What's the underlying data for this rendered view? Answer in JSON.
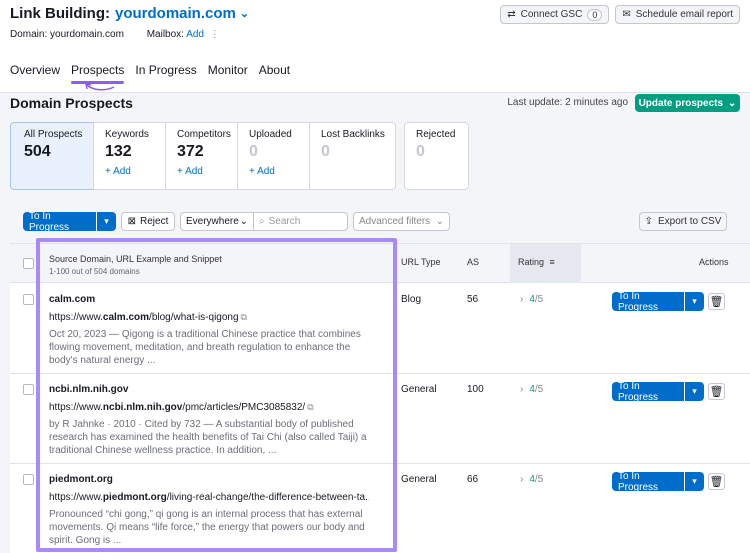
{
  "header": {
    "title": "Link Building:",
    "domain": "yourdomain.com",
    "domain_label": "Domain: yourdomain.com",
    "mailbox_label": "Mailbox:",
    "mailbox_add": "Add",
    "connect_gsc": "Connect GSC",
    "gsc_count": "0",
    "schedule": "Schedule email report"
  },
  "tabs": [
    "Overview",
    "Prospects",
    "In Progress",
    "Monitor",
    "About"
  ],
  "section": {
    "title": "Domain Prospects",
    "last_update": "Last update: 2 minutes ago",
    "update_button": "Update prospects"
  },
  "cards": [
    {
      "label": "All Prospects",
      "value": "504",
      "add": ""
    },
    {
      "label": "Keywords",
      "value": "132",
      "add": "+ Add"
    },
    {
      "label": "Competitors",
      "value": "372",
      "add": "+ Add"
    },
    {
      "label": "Uploaded",
      "value": "0",
      "add": "+ Add"
    },
    {
      "label": "Lost Backlinks",
      "value": "0",
      "add": ""
    },
    {
      "label": "Rejected",
      "value": "0",
      "add": ""
    }
  ],
  "toolbar": {
    "to_in_progress": "To In Progress",
    "reject": "Reject",
    "scope": "Everywhere",
    "search_placeholder": "Search",
    "advanced": "Advanced filters",
    "export": "Export to CSV"
  },
  "table": {
    "col_source": "Source Domain, URL Example and Snippet",
    "col_source_sub": "1-100 out of 504 domains",
    "col_url_type": "URL Type",
    "col_as": "AS",
    "col_rating": "Rating",
    "col_actions": "Actions",
    "rows": [
      {
        "domain": "calm.com",
        "url_pre": "https://www.",
        "url_bold": "calm.com",
        "url_post": "/blog/what-is-qigong",
        "snippet": "Oct 20, 2023 — Qigong is a traditional Chinese practice that combines flowing movement, meditation, and breath regulation to enhance the body's natural energy ...",
        "url_type": "Blog",
        "as": "56",
        "rating": "4",
        "rating_max": "/5",
        "action": "To In Progress"
      },
      {
        "domain": "ncbi.nlm.nih.gov",
        "url_pre": "https://www.",
        "url_bold": "ncbi.nlm.nih.gov",
        "url_post": "/pmc/articles/PMC3085832/",
        "snippet": "by R Jahnke · 2010 · Cited by 732 — A substantial body of published research has examined the health benefits of Tai Chi (also called Taiji) a traditional Chinese wellness practice. In addition, ...",
        "url_type": "General",
        "as": "100",
        "rating": "4",
        "rating_max": "/5",
        "action": "To In Progress"
      },
      {
        "domain": "piedmont.org",
        "url_pre": "https://www.",
        "url_bold": "piedmont.org",
        "url_post": "/living-real-change/the-difference-between-ta...",
        "snippet": "Pronounced “chi gong,” qi gong is an internal process that has external movements. Qi means “life force,” the energy that powers our body and spirit. Gong is ...",
        "url_type": "General",
        "as": "66",
        "rating": "4",
        "rating_max": "/5",
        "action": "To In Progress"
      }
    ]
  },
  "colors": {
    "accent": "#006dca",
    "green": "#009f81",
    "highlight": "#a78bfa"
  }
}
